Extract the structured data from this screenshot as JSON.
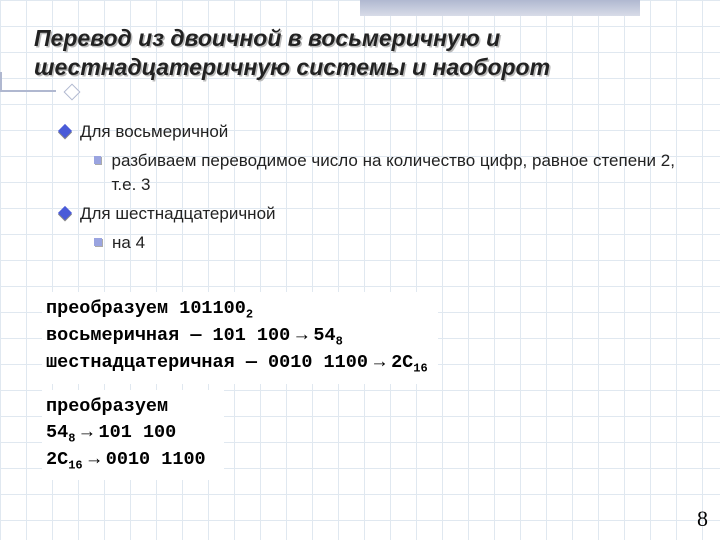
{
  "title": "Перевод из двоичной в восьмеричную и шестнадцатеричную системы и наоборот",
  "bullets": {
    "oct_head": "Для восьмеричной",
    "oct_sub": "разбиваем переводимое число на количество цифр, равное степени 2, т.е. 3",
    "hex_head": "Для шестнадцатеричной",
    "hex_sub": "на 4"
  },
  "example1": {
    "l1a": "преобразуем 101100",
    "l1b": "2",
    "l2a": "восьмеричная — 101 100",
    "l2arrow": "→",
    "l2b": "54",
    "l2c": "8",
    "l3a": "шестнадцатеричная — 0010 1100",
    "l3arrow": "→",
    "l3b": "2C",
    "l3c": "16"
  },
  "example2": {
    "l1": "преобразуем",
    "l2a": "54",
    "l2b": "8",
    "l2arrow": "→",
    "l2c": "101 100",
    "l3a": "2C",
    "l3b": "16",
    "l3arrow": "→",
    "l3c": "0010 1100"
  },
  "page": "8"
}
